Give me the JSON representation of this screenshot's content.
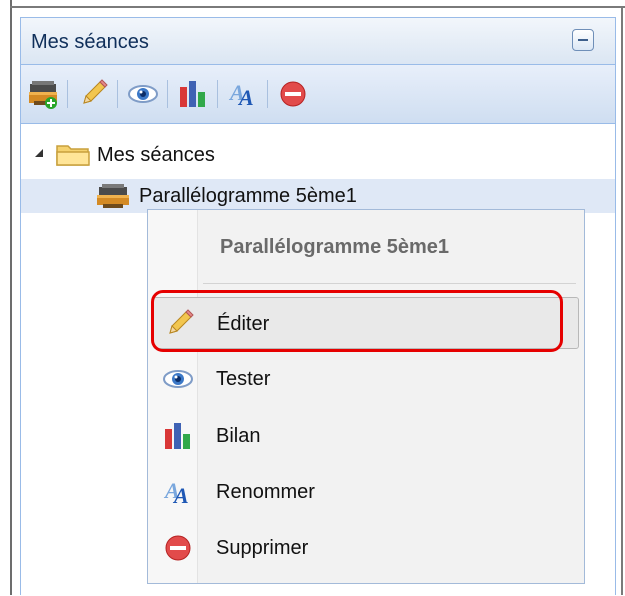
{
  "panel": {
    "title": "Mes séances"
  },
  "toolbar": {
    "icons": [
      "new-session-icon",
      "pencil-icon",
      "eye-icon",
      "bar-chart-icon",
      "rename-icon",
      "delete-icon"
    ]
  },
  "tree": {
    "root_label": "Mes séances",
    "child_label": "Parallélogramme 5ème1"
  },
  "context_menu": {
    "title": "Parallélogramme 5ème1",
    "items": [
      {
        "label": "Éditer",
        "icon": "pencil-icon"
      },
      {
        "label": "Tester",
        "icon": "eye-icon"
      },
      {
        "label": "Bilan",
        "icon": "bar-chart-icon"
      },
      {
        "label": "Renommer",
        "icon": "rename-icon"
      },
      {
        "label": "Supprimer",
        "icon": "delete-icon"
      }
    ]
  },
  "colors": {
    "highlight": "#e60000",
    "selected_row": "#dfe8f6",
    "panel_border": "#99bbe8"
  }
}
